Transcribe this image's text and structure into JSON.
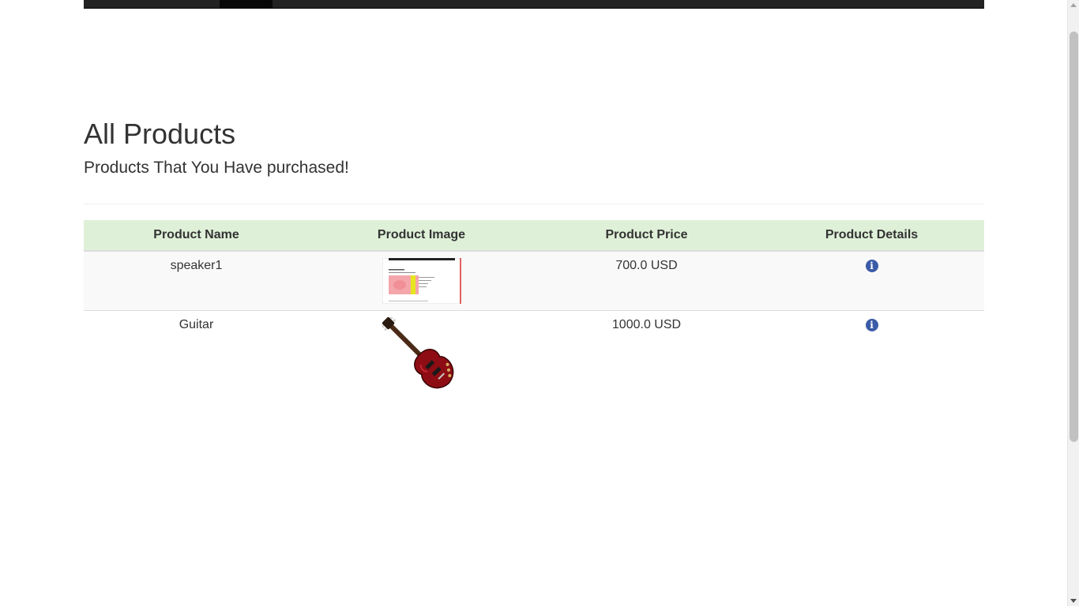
{
  "page": {
    "title": "All Products",
    "subtitle": "Products That You Have purchased!"
  },
  "table": {
    "headers": [
      "Product Name",
      "Product Image",
      "Product Price",
      "Product Details"
    ],
    "rows": [
      {
        "name": "speaker1",
        "image": "speaker-screenshot-thumbnail",
        "price": "700.0 USD",
        "details_icon": "info-circle-icon"
      },
      {
        "name": "Guitar",
        "image": "red-electric-guitar",
        "price": "1000.0 USD",
        "details_icon": "info-circle-icon"
      }
    ]
  },
  "colors": {
    "header_row": "#dff0d8",
    "navbar": "#222222",
    "info_icon": "#3b5ba8"
  },
  "icons": {
    "info_glyph": "i"
  }
}
